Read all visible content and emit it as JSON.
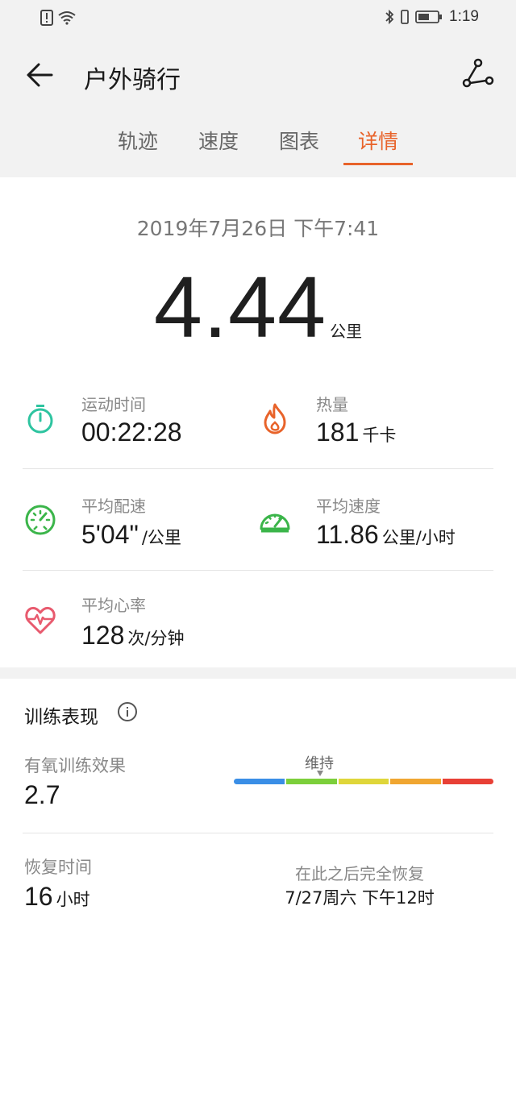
{
  "status_bar": {
    "time": "1:19",
    "icons": [
      "alert-icon",
      "wifi-icon",
      "bluetooth-icon",
      "vibrate-icon",
      "battery-icon"
    ]
  },
  "header": {
    "title": "户外骑行",
    "back_icon": "arrow-left-icon",
    "route_icon": "route-icon"
  },
  "tabs": [
    {
      "label": "轨迹",
      "active": false
    },
    {
      "label": "速度",
      "active": false
    },
    {
      "label": "图表",
      "active": false
    },
    {
      "label": "详情",
      "active": true
    }
  ],
  "summary": {
    "date": "2019年7月26日 下午7:41",
    "distance": "4.44",
    "distance_unit": "公里"
  },
  "stats": {
    "duration": {
      "label": "运动时间",
      "value": "00:22:28",
      "unit": "",
      "icon": "stopwatch-icon",
      "color": "#2ec4a0"
    },
    "calories": {
      "label": "热量",
      "value": "181",
      "unit": "千卡",
      "icon": "flame-icon",
      "color": "#e8632a"
    },
    "avg_pace": {
      "label": "平均配速",
      "value": "5'04\"",
      "unit": "/公里",
      "icon": "pace-gauge-icon",
      "color": "#3bb54a"
    },
    "avg_speed": {
      "label": "平均速度",
      "value": "11.86",
      "unit": "公里/小时",
      "icon": "speedometer-icon",
      "color": "#3bb54a"
    },
    "avg_heart_rate": {
      "label": "平均心率",
      "value": "128",
      "unit": "次/分钟",
      "icon": "heart-rate-icon",
      "color": "#e85a6e"
    }
  },
  "training": {
    "title": "训练表现",
    "info_icon": "info-icon",
    "aerobic": {
      "label": "有氧训练效果",
      "value": "2.7",
      "level_label": "维持",
      "level_index": 1,
      "scale_colors": [
        "#3a8ee6",
        "#7ccf3b",
        "#dfd63a",
        "#f0a631",
        "#e84036"
      ]
    },
    "recovery": {
      "label": "恢复时间",
      "value": "16",
      "unit": "小时",
      "note": "在此之后完全恢复",
      "time": "7/27周六 下午12时"
    }
  }
}
